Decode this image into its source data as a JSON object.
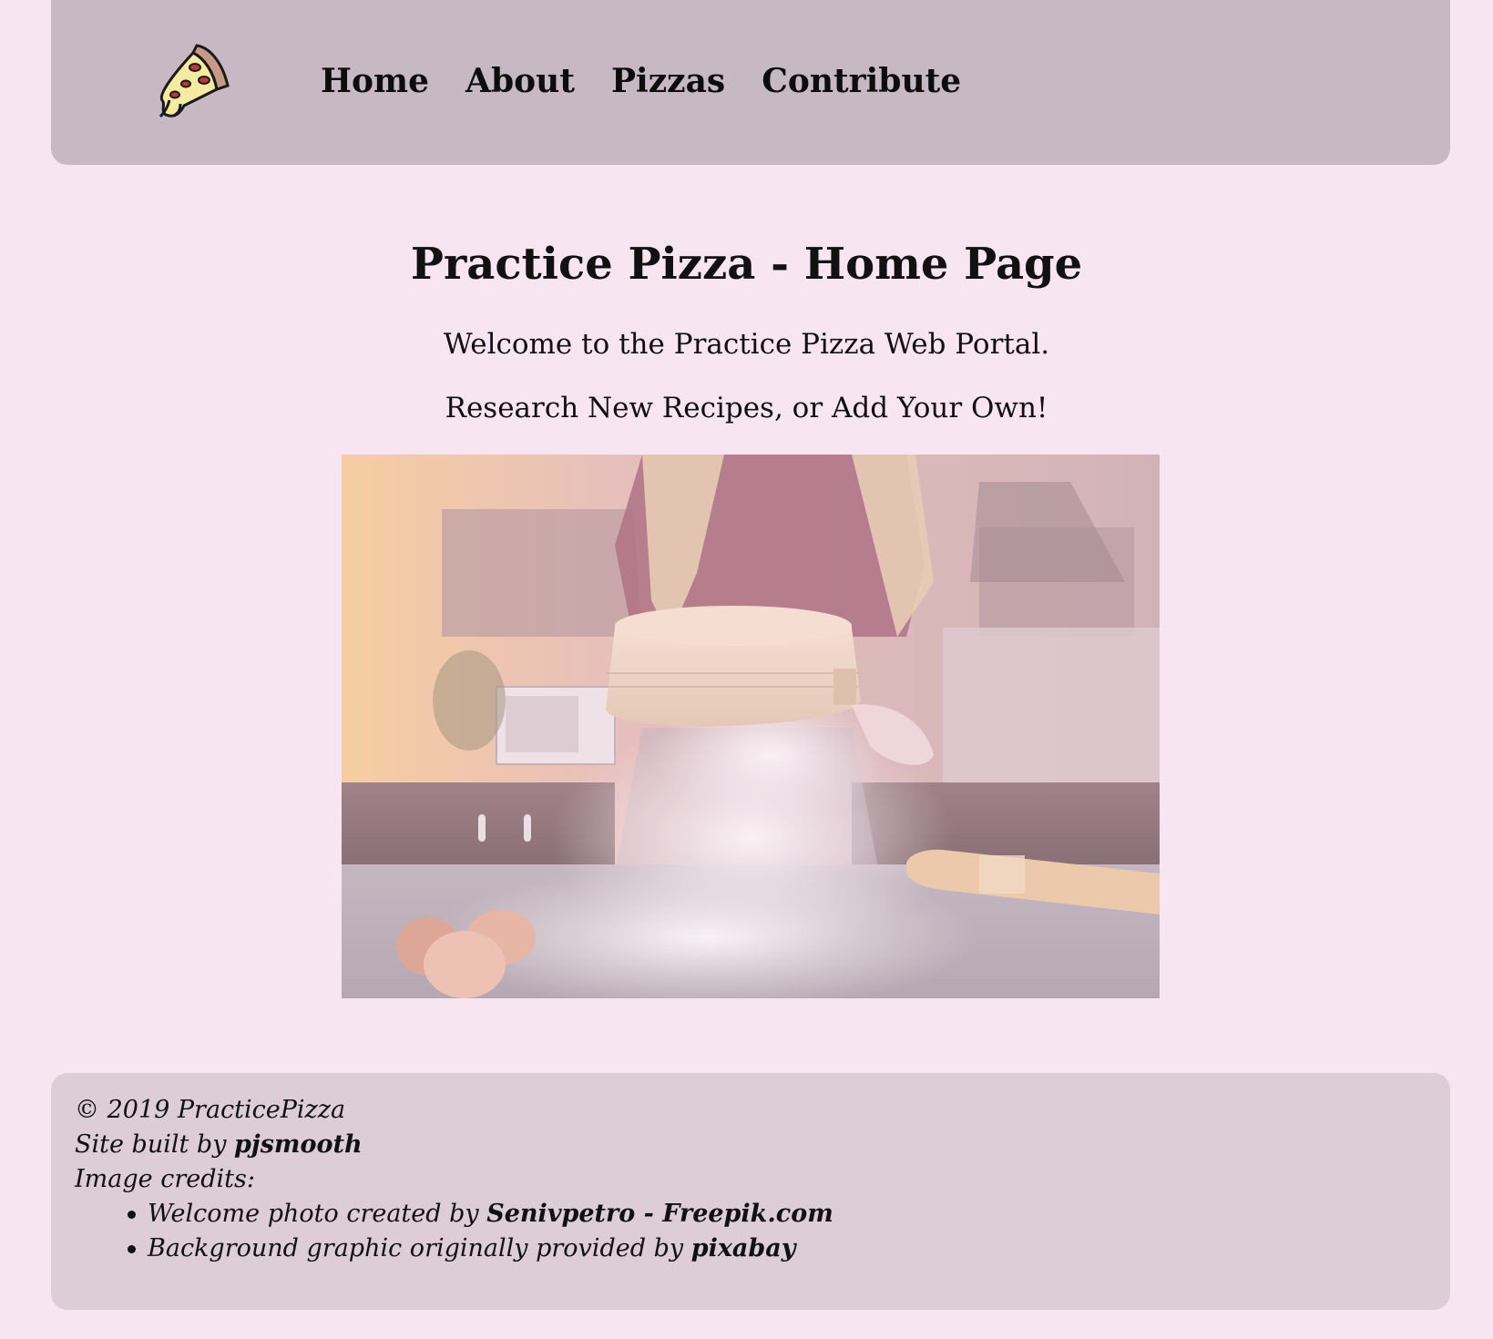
{
  "nav": {
    "logo_icon": "pizza-slice-icon",
    "links": [
      "Home",
      "About",
      "Pizzas",
      "Contribute"
    ]
  },
  "main": {
    "title": "Practice Pizza - Home Page",
    "welcome": "Welcome to the Practice Pizza Web Portal.",
    "tagline": "Research New Recipes, or Add Your Own!"
  },
  "footer": {
    "copyright": "© 2019 PracticePizza",
    "built_by_prefix": "Site built by ",
    "built_by_name": "pjsmooth",
    "credits_heading": "Image credits:",
    "credit_1_prefix": "Welcome photo created by ",
    "credit_1_name": "Senivpetro - Freepik.com",
    "credit_2_prefix": "Background graphic originally provided by ",
    "credit_2_name": "pixabay"
  },
  "colors": {
    "page_bg": "#f7e6f1",
    "nav_bg": "#c7b9c3",
    "footer_bg": "#dccdd7"
  }
}
